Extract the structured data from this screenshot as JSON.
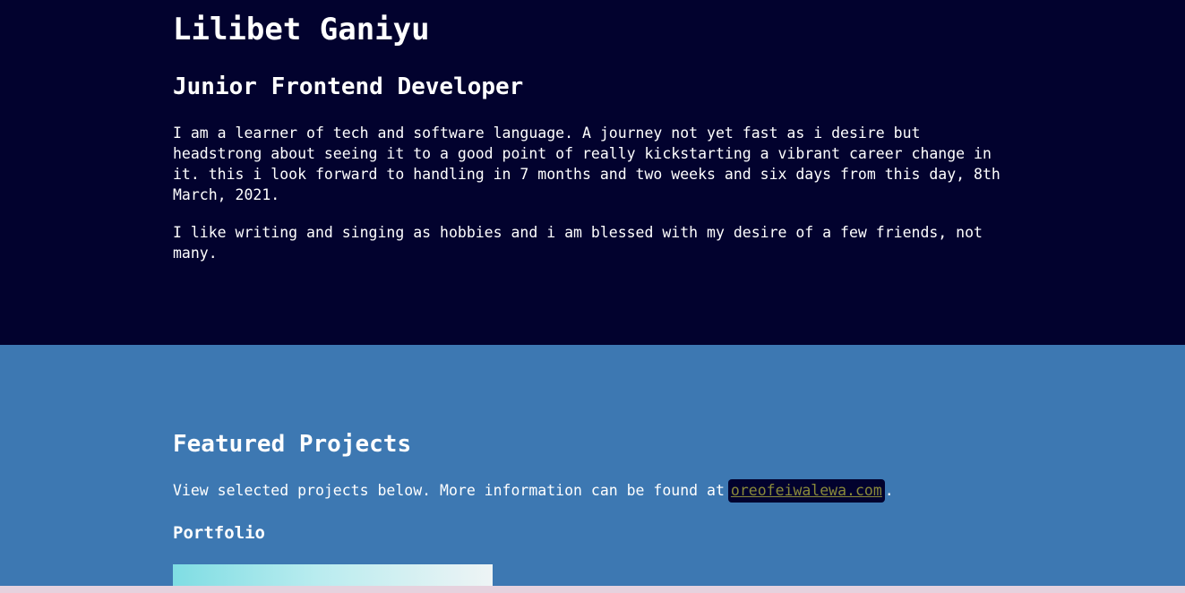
{
  "header": {
    "name": "Lilibet Ganiyu",
    "role": "Junior Frontend Developer",
    "paragraph1": "I am a learner of tech and software language. A journey not yet fast as i desire but headstrong about seeing it to a good point of really kickstarting a vibrant career change in it. this i look forward to handling in 7 months and two weeks and six days from this day, 8th March, 2021.",
    "paragraph2": "I like writing and singing as hobbies and i am blessed with my desire of a few friends, not many."
  },
  "projects": {
    "title": "Featured Projects",
    "intro_text": "View selected projects below. More information can be found at",
    "link_text": "oreofeiwalewa.com",
    "trailing": ".",
    "portfolio_title": "Portfolio"
  },
  "colors": {
    "intro_bg": "#02022e",
    "projects_bg": "#3d78b2",
    "link_color": "#8a8a3a"
  }
}
